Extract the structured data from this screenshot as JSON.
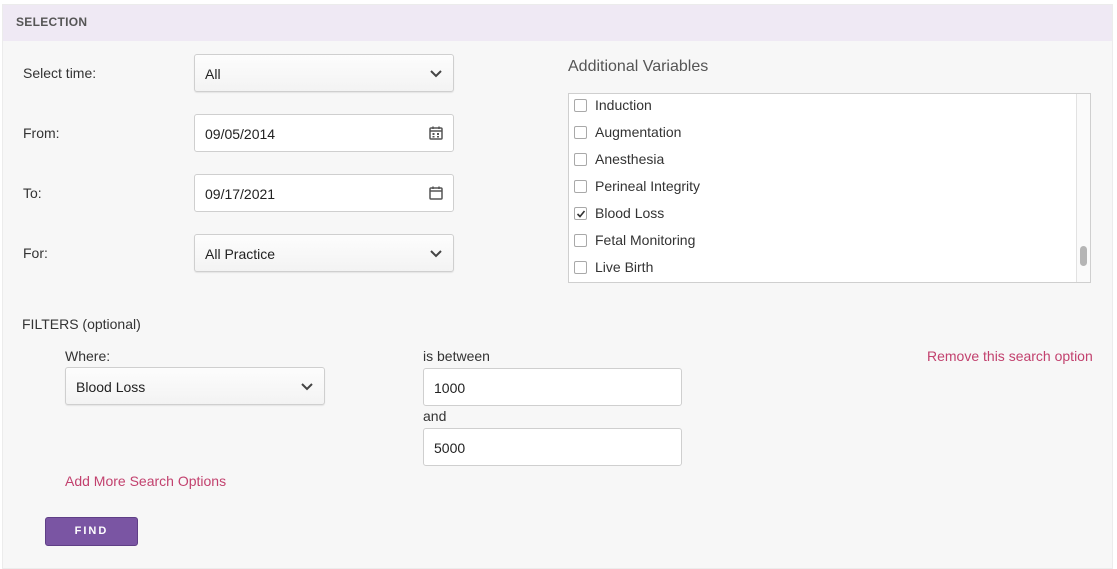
{
  "section_header": "SELECTION",
  "form": {
    "select_time": {
      "label": "Select time:",
      "value": "All"
    },
    "from": {
      "label": "From:",
      "value": "09/05/2014"
    },
    "to": {
      "label": "To:",
      "value": "09/17/2021"
    },
    "for": {
      "label": "For:",
      "value": "All Practice"
    }
  },
  "additional_variables": {
    "title": "Additional Variables",
    "items": [
      {
        "label": "Induction",
        "checked": false
      },
      {
        "label": "Augmentation",
        "checked": false
      },
      {
        "label": "Anesthesia",
        "checked": false
      },
      {
        "label": "Perineal Integrity",
        "checked": false
      },
      {
        "label": "Blood Loss",
        "checked": true
      },
      {
        "label": "Fetal Monitoring",
        "checked": false
      },
      {
        "label": "Live Birth",
        "checked": false
      }
    ]
  },
  "filters": {
    "title": "FILTERS (optional)",
    "where_label": "Where:",
    "where_value": "Blood Loss",
    "operator_label": "is between",
    "min_value": "1000",
    "and_label": "and",
    "max_value": "5000",
    "remove_link": "Remove this search option",
    "add_link": "Add More Search Options"
  },
  "find_button": "FIND",
  "icons": {
    "chevron": "chevron-down-icon",
    "calendar": "calendar-icon",
    "check": "checkmark-icon"
  },
  "colors": {
    "accent": "#7a55a3",
    "link": "#c2416e",
    "header_bg": "#efe9f4"
  }
}
